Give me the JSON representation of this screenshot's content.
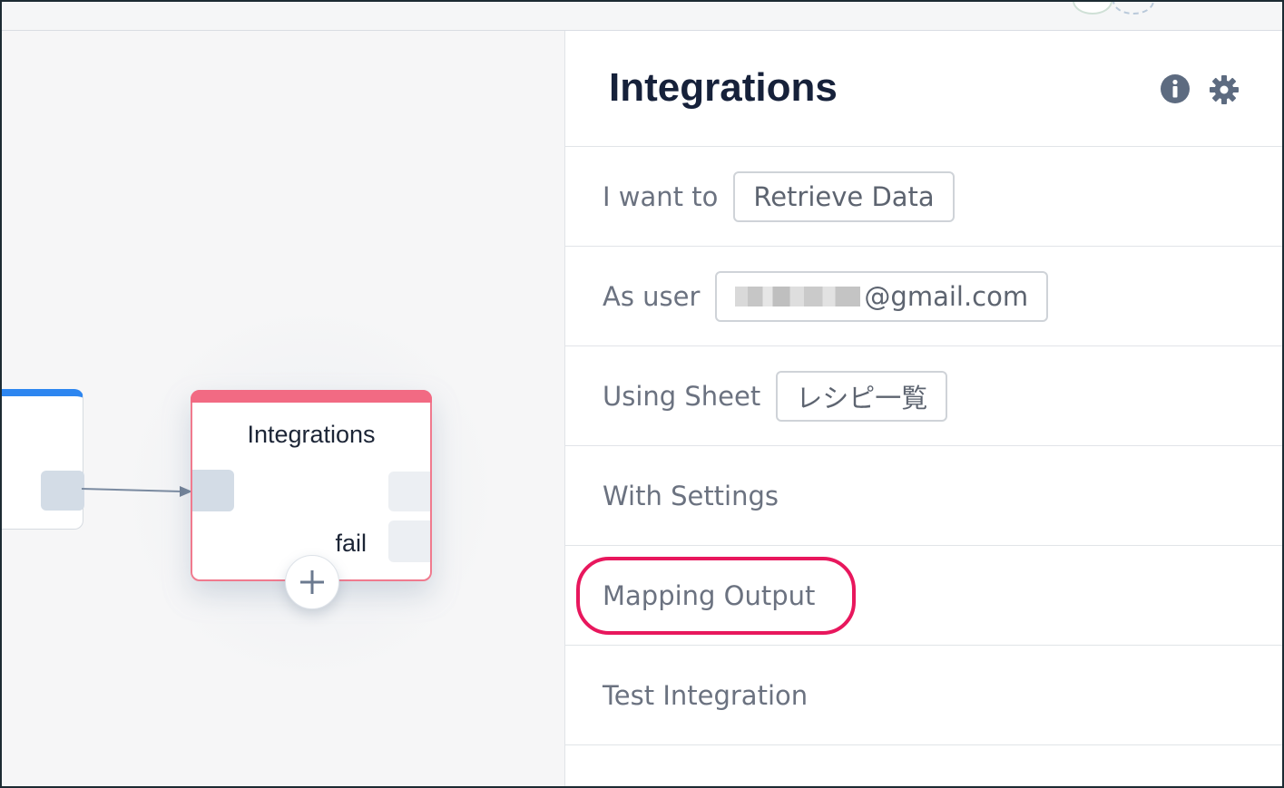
{
  "node": {
    "title": "Integrations",
    "fail_label": "fail"
  },
  "panel": {
    "title": "Integrations",
    "rows": [
      {
        "label": "I want to",
        "value": "Retrieve Data"
      },
      {
        "label": "As user",
        "value": "@gmail.com"
      },
      {
        "label": "Using Sheet",
        "value": "レシピ一覧"
      },
      {
        "label": "With Settings"
      },
      {
        "label": "Mapping Output"
      },
      {
        "label": "Test Integration"
      }
    ]
  },
  "icons": {
    "info": "info-icon",
    "settings": "gear-icon",
    "add": "plus-icon"
  },
  "colors": {
    "trigger_accent": "#2d86f0",
    "node_accent": "#f26a83",
    "highlight": "#e8175d",
    "title_text": "#16213a",
    "label_text": "#6b7280"
  }
}
